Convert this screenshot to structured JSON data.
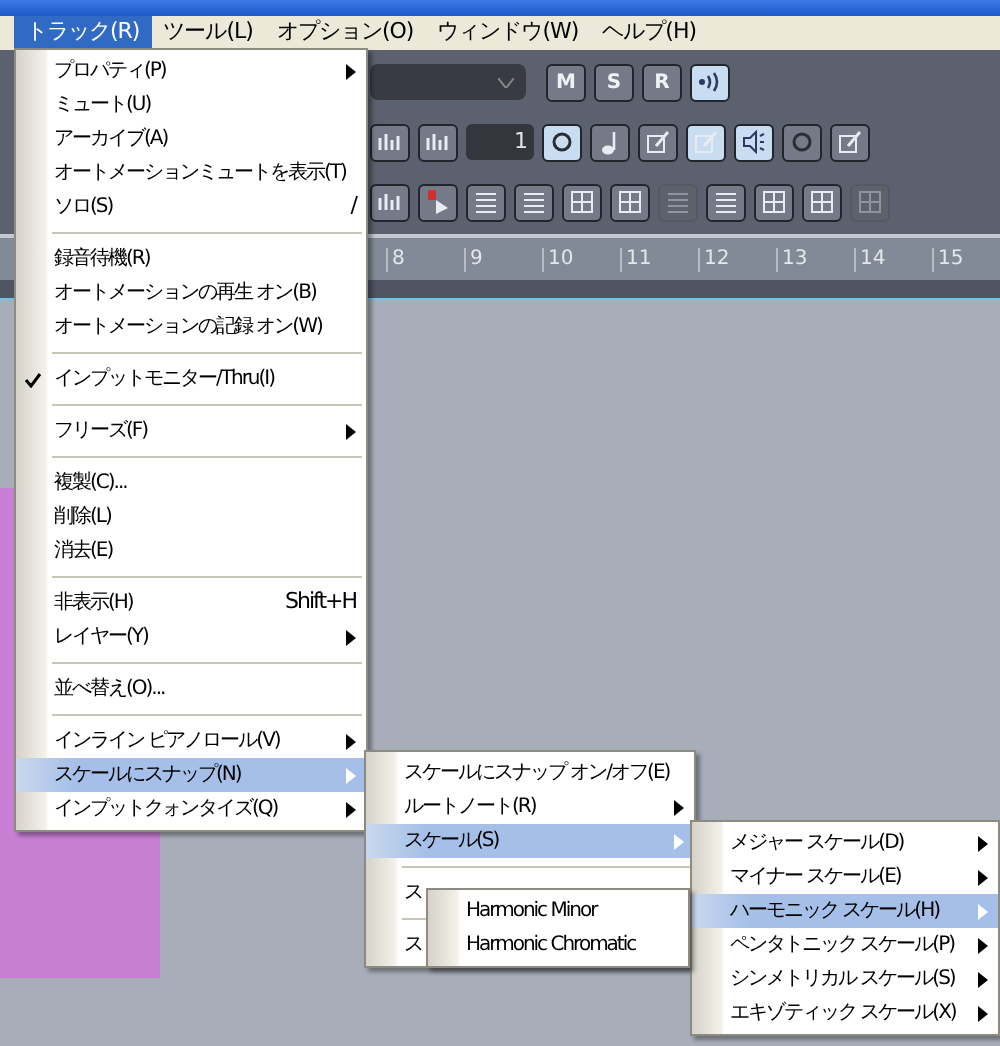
{
  "menu_bar": [
    {
      "label": "トラック(R)",
      "selected": true
    },
    {
      "label": "ツール(L)",
      "selected": false
    },
    {
      "label": "オプション(O)",
      "selected": false
    },
    {
      "label": "ウィンドウ(W)",
      "selected": false
    },
    {
      "label": "ヘルプ(H)",
      "selected": false
    }
  ],
  "toolbar_rows": [
    [
      {
        "kind": "dropdown",
        "selected": false,
        "disabled": false
      },
      {
        "kind": "text",
        "label": "M",
        "selected": false,
        "disabled": false
      },
      {
        "kind": "text",
        "label": "S",
        "selected": false,
        "disabled": false
      },
      {
        "kind": "text",
        "label": "R",
        "selected": false,
        "disabled": false
      },
      {
        "kind": "wave",
        "selected": true,
        "disabled": false
      }
    ],
    [
      {
        "kind": "bars",
        "selected": false,
        "disabled": false
      },
      {
        "kind": "bars",
        "selected": false,
        "disabled": false
      },
      {
        "kind": "field",
        "label": "1",
        "selected": false,
        "disabled": false
      },
      {
        "kind": "circle",
        "selected": true,
        "disabled": false
      },
      {
        "kind": "note",
        "selected": false,
        "disabled": false
      },
      {
        "kind": "edit",
        "selected": false,
        "disabled": false
      },
      {
        "kind": "edit",
        "selected": true,
        "disabled": false
      },
      {
        "kind": "speaker",
        "selected": true,
        "disabled": false
      },
      {
        "kind": "circle",
        "selected": false,
        "disabled": false
      },
      {
        "kind": "edit",
        "selected": false,
        "disabled": false
      }
    ],
    [
      {
        "kind": "bars",
        "selected": false,
        "disabled": false
      },
      {
        "kind": "play",
        "selected": false,
        "disabled": false
      },
      {
        "kind": "lines",
        "selected": false,
        "disabled": false
      },
      {
        "kind": "lines",
        "selected": false,
        "disabled": false
      },
      {
        "kind": "grid",
        "selected": false,
        "disabled": false
      },
      {
        "kind": "grid",
        "selected": false,
        "disabled": false
      },
      {
        "kind": "lines",
        "selected": false,
        "disabled": true
      },
      {
        "kind": "lines",
        "selected": false,
        "disabled": false
      },
      {
        "kind": "grid",
        "selected": false,
        "disabled": false
      },
      {
        "kind": "grid",
        "selected": false,
        "disabled": false
      },
      {
        "kind": "grid",
        "selected": false,
        "disabled": true
      }
    ]
  ],
  "ruler": [
    "8",
    "9",
    "10",
    "11",
    "12",
    "13",
    "14",
    "15"
  ],
  "track_menu": [
    {
      "kind": "item",
      "label": "プロパティ(P)",
      "submenu": true,
      "checked": false,
      "selected": false
    },
    {
      "kind": "item",
      "label": "ミュート(U)",
      "submenu": false,
      "checked": false,
      "selected": false
    },
    {
      "kind": "item",
      "label": "アーカイブ(A)",
      "submenu": false,
      "checked": false,
      "selected": false
    },
    {
      "kind": "item",
      "label": "オートメーションミュートを表示(T)",
      "submenu": false,
      "checked": false,
      "selected": false
    },
    {
      "kind": "item",
      "label": "ソロ(S)",
      "shortcut": "/",
      "submenu": false,
      "checked": false,
      "selected": false
    },
    {
      "kind": "separator"
    },
    {
      "kind": "item",
      "label": "録音待機(R)",
      "submenu": false,
      "checked": false,
      "selected": false
    },
    {
      "kind": "item",
      "label": "オートメーションの再生 オン(B)",
      "submenu": false,
      "checked": false,
      "selected": false
    },
    {
      "kind": "item",
      "label": "オートメーションの記録 オン(W)",
      "submenu": false,
      "checked": false,
      "selected": false
    },
    {
      "kind": "separator"
    },
    {
      "kind": "item",
      "label": "インプットモニター/Thru(I)",
      "submenu": false,
      "checked": true,
      "selected": false
    },
    {
      "kind": "separator"
    },
    {
      "kind": "item",
      "label": "フリーズ(F)",
      "submenu": true,
      "checked": false,
      "selected": false
    },
    {
      "kind": "separator"
    },
    {
      "kind": "item",
      "label": "複製(C)...",
      "submenu": false,
      "checked": false,
      "selected": false
    },
    {
      "kind": "item",
      "label": "削除(L)",
      "submenu": false,
      "checked": false,
      "selected": false
    },
    {
      "kind": "item",
      "label": "消去(E)",
      "submenu": false,
      "checked": false,
      "selected": false
    },
    {
      "kind": "separator"
    },
    {
      "kind": "item",
      "label": "非表示(H)",
      "shortcut": "Shift+H",
      "submenu": false,
      "checked": false,
      "selected": false
    },
    {
      "kind": "item",
      "label": "レイヤー(Y)",
      "submenu": true,
      "checked": false,
      "selected": false
    },
    {
      "kind": "separator"
    },
    {
      "kind": "item",
      "label": "並べ替え(O)...",
      "submenu": false,
      "checked": false,
      "selected": false
    },
    {
      "kind": "separator"
    },
    {
      "kind": "item",
      "label": "インライン ピアノロール(V)",
      "submenu": true,
      "checked": false,
      "selected": false
    },
    {
      "kind": "item",
      "label": "スケールにスナップ(N)",
      "submenu": true,
      "checked": false,
      "selected": true
    },
    {
      "kind": "item",
      "label": "インプットクォンタイズ(Q)",
      "submenu": true,
      "checked": false,
      "selected": false
    }
  ],
  "snap_menu": [
    {
      "kind": "item",
      "label": "スケールにスナップ オン/オフ(E)",
      "submenu": false,
      "checked": false,
      "selected": false
    },
    {
      "kind": "item",
      "label": "ルートノート(R)",
      "submenu": true,
      "checked": false,
      "selected": false
    },
    {
      "kind": "item",
      "label": "スケール(S)",
      "submenu": true,
      "checked": false,
      "selected": true
    },
    {
      "kind": "separator"
    },
    {
      "kind": "item",
      "label": "ス",
      "checked": false,
      "selected": false
    },
    {
      "kind": "separator"
    },
    {
      "kind": "item",
      "label": "ス",
      "checked": false,
      "selected": false
    }
  ],
  "scale_menu": [
    {
      "kind": "item",
      "label": "メジャー スケール(D)",
      "submenu": true,
      "checked": false,
      "selected": false
    },
    {
      "kind": "item",
      "label": "マイナー スケール(E)",
      "submenu": true,
      "checked": false,
      "selected": false
    },
    {
      "kind": "item",
      "label": "ハーモニック スケール(H)",
      "submenu": true,
      "checked": false,
      "selected": true
    },
    {
      "kind": "item",
      "label": "ペンタトニック スケール(P)",
      "submenu": true,
      "checked": false,
      "selected": false
    },
    {
      "kind": "item",
      "label": "シンメトリカル スケール(S)",
      "submenu": true,
      "checked": false,
      "selected": false
    },
    {
      "kind": "item",
      "label": "エキゾティック スケール(X)",
      "submenu": true,
      "checked": false,
      "selected": false
    }
  ],
  "harmonic_menu": [
    {
      "kind": "item",
      "label": "Harmonic Minor",
      "submenu": false,
      "checked": false,
      "selected": false
    },
    {
      "kind": "item",
      "label": "Harmonic Chromatic",
      "submenu": false,
      "checked": false,
      "selected": false
    }
  ]
}
